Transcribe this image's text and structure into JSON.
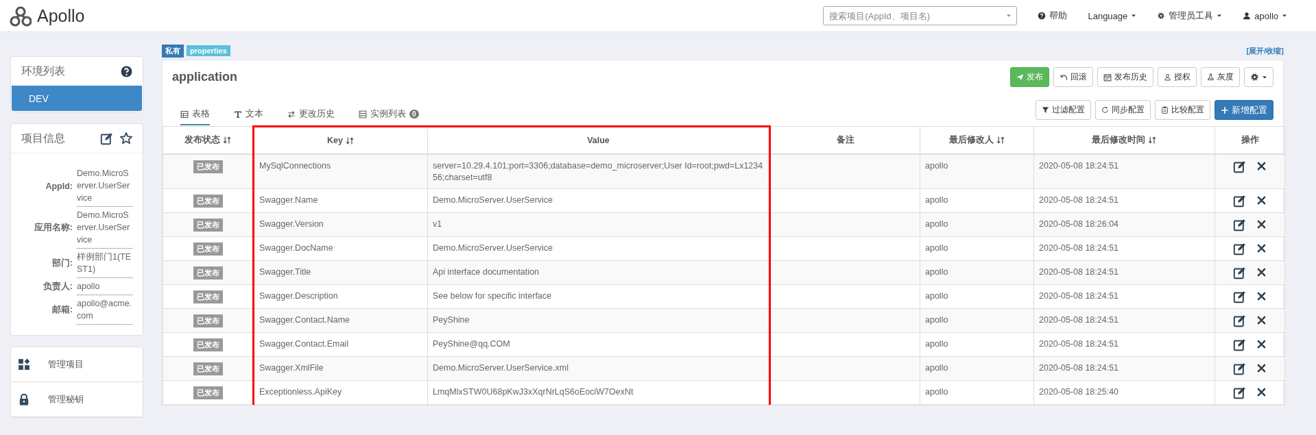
{
  "top_bar": {
    "logo_text": "Apollo",
    "search": {
      "placeholder": "搜索项目(AppId、项目名)"
    },
    "nav": [
      {
        "label": "帮助",
        "kind": "help"
      },
      {
        "label": "Language",
        "kind": "dropdown"
      },
      {
        "label": "管理员工具",
        "kind": "tools"
      },
      {
        "label": "apollo",
        "kind": "user"
      }
    ]
  },
  "sidebar": {
    "environments": {
      "title": "环境列表",
      "items": [
        {
          "label": "DEV",
          "selected": true
        }
      ]
    },
    "project_info": {
      "title": "项目信息",
      "fields": [
        {
          "label": "AppId:",
          "value": "Demo.MicroServer.UserService"
        },
        {
          "label": "应用名称:",
          "value": "Demo.MicroServer.UserService"
        },
        {
          "label": "部门:",
          "value": "样例部门1(TEST1)"
        },
        {
          "label": "负责人:",
          "value": "apollo"
        },
        {
          "label": "邮箱:",
          "value": "apollo@acme.com"
        }
      ]
    },
    "menu": [
      {
        "label": "管理项目",
        "kind": "manage"
      },
      {
        "label": "管理秘钥",
        "kind": "lock"
      }
    ]
  },
  "namespace": {
    "tags": [
      {
        "label": "私有",
        "kind": "scope"
      },
      {
        "label": "properties",
        "kind": "format"
      }
    ],
    "toggle_link": "[展开/收缩]",
    "name": "application",
    "actions": [
      {
        "label": "发布",
        "kind": "publish"
      },
      {
        "label": "回滚",
        "kind": "rollback"
      },
      {
        "label": "发布历史",
        "kind": "history"
      },
      {
        "label": "授权",
        "kind": "auth"
      },
      {
        "label": "灰度",
        "kind": "gray"
      }
    ],
    "tabs": [
      {
        "label": "表格",
        "kind": "table",
        "selected": true
      },
      {
        "label": "文本",
        "kind": "text",
        "selected": false
      },
      {
        "label": "更改历史",
        "kind": "history",
        "selected": false
      },
      {
        "label": "实例列表",
        "kind": "instances",
        "selected": false,
        "badge": "0"
      }
    ],
    "tools": [
      {
        "label": "过滤配置",
        "kind": "filter"
      },
      {
        "label": "同步配置",
        "kind": "sync"
      },
      {
        "label": "比较配置",
        "kind": "compare"
      },
      {
        "label": "新增配置",
        "kind": "add"
      }
    ],
    "table": {
      "columns": [
        {
          "label": "发布状态",
          "sortable": true
        },
        {
          "label": "Key",
          "sortable": true
        },
        {
          "label": "Value",
          "sortable": false
        },
        {
          "label": "备注",
          "sortable": false
        },
        {
          "label": "最后修改人",
          "sortable": true
        },
        {
          "label": "最后修改时间",
          "sortable": true
        },
        {
          "label": "操作",
          "sortable": false
        }
      ],
      "rows": [
        {
          "status": "已发布",
          "key": "MySqlConnections",
          "value": "server=10.29.4.101;port=3306;database=demo_microserver;User Id=root;pwd=Lx123456;charset=utf8",
          "modifier": "apollo",
          "modified_time": "2020-05-08 18:24:51"
        },
        {
          "status": "已发布",
          "key": "Swagger.Name",
          "value": "Demo.MicroServer.UserService",
          "modifier": "apollo",
          "modified_time": "2020-05-08 18:24:51"
        },
        {
          "status": "已发布",
          "key": "Swagger.Version",
          "value": "v1",
          "modifier": "apollo",
          "modified_time": "2020-05-08 18:26:04"
        },
        {
          "status": "已发布",
          "key": "Swagger.DocName",
          "value": "Demo.MicroServer.UserService",
          "modifier": "apollo",
          "modified_time": "2020-05-08 18:24:51"
        },
        {
          "status": "已发布",
          "key": "Swagger.Title",
          "value": "Api interface documentation",
          "modifier": "apollo",
          "modified_time": "2020-05-08 18:24:51"
        },
        {
          "status": "已发布",
          "key": "Swagger.Description",
          "value": "See below for specific interface",
          "modifier": "apollo",
          "modified_time": "2020-05-08 18:24:51"
        },
        {
          "status": "已发布",
          "key": "Swagger.Contact.Name",
          "value": "PeyShine",
          "modifier": "apollo",
          "modified_time": "2020-05-08 18:24:51"
        },
        {
          "status": "已发布",
          "key": "Swagger.Contact.Email",
          "value": "PeyShine@qq.COM",
          "modifier": "apollo",
          "modified_time": "2020-05-08 18:24:51"
        },
        {
          "status": "已发布",
          "key": "Swagger.XmlFile",
          "value": "Demo.MicroServer.UserService.xml",
          "modifier": "apollo",
          "modified_time": "2020-05-08 18:24:51"
        },
        {
          "status": "已发布",
          "key": "Exceptionless.ApiKey",
          "value": "LmqMlxSTW0U68pKwJ3xXqrNrLqS6oEociW7OexNt",
          "modifier": "apollo",
          "modified_time": "2020-05-08 18:25:40"
        }
      ]
    }
  }
}
